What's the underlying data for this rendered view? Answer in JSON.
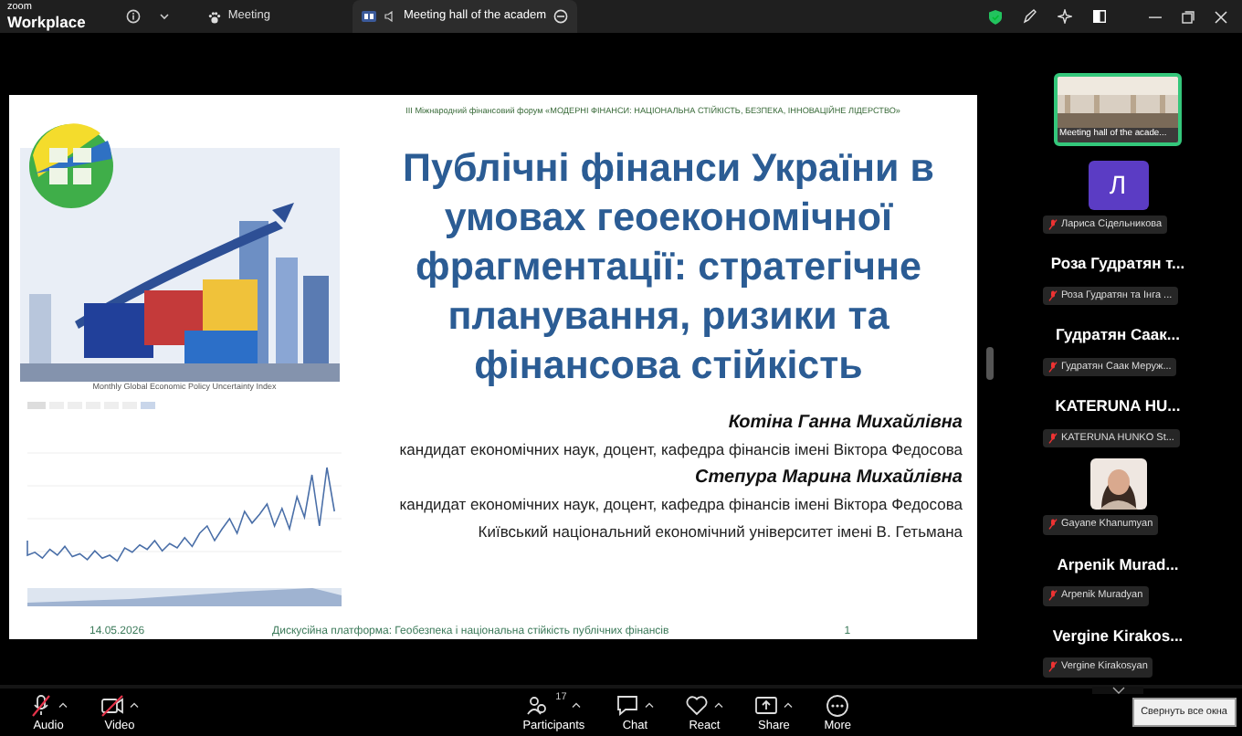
{
  "app": {
    "logo_top": "zoom",
    "logo_bottom": "Workplace"
  },
  "tabs": [
    {
      "label": "Meeting",
      "kind": "meeting",
      "selected": false
    },
    {
      "label": "Meeting hall of the academ",
      "kind": "share",
      "selected": true
    }
  ],
  "slide": {
    "header": "III Міжнародний фінансовий форум «МОДЕРНІ ФІНАНСИ: НАЦІОНАЛЬНА СТІЙКІСТЬ, БЕЗПЕКА, ІННОВАЦІЙНЕ ЛІДЕРСТВО»",
    "title_lines": [
      "Публічні фінанси України в",
      "умовах геоекономічної",
      "фрагментації: стратегічне",
      "планування, ризики та",
      "фінансова стійкість"
    ],
    "chart_title": "Monthly Global Economic Policy Uncertainty Index",
    "authors": [
      {
        "kind": "name",
        "text": "Котіна Ганна Михайлівна"
      },
      {
        "kind": "affiliation",
        "text": "кандидат економічних наук, доцент, кафедра фінансів імені Віктора Федосова"
      },
      {
        "kind": "name",
        "text": "Степура Марина Михайлівна"
      },
      {
        "kind": "affiliation",
        "text": "кандидат економічних наук, доцент, кафедра фінансів імені Віктора Федосова"
      },
      {
        "kind": "affiliation",
        "text": "Київський національний економічний університет  імені В. Гетьмана"
      }
    ],
    "footer": {
      "date": "14.05.2026",
      "platform": "Дискусійна платформа: Геобезпека і національна стійкість публічних фінансів",
      "page": "1"
    }
  },
  "participants": [
    {
      "kind": "video",
      "label": "Meeting hall of the acade...",
      "selected": true
    },
    {
      "kind": "avatar",
      "initial": "Л",
      "color": "#5b3cc4",
      "label": "Лариса Сідельникова",
      "selected": false,
      "muted": true
    },
    {
      "kind": "name",
      "name": "Роза Гудратян т...",
      "label": "Роза Гудратян та Інга ...",
      "selected": false,
      "muted": true
    },
    {
      "kind": "name",
      "name": "Гудратян Саак...",
      "label": "Гудратян Саак Меруж...",
      "selected": false,
      "muted": true
    },
    {
      "kind": "name",
      "name": "KATERUNA HU...",
      "label": "KATERUNA HUNKO St...",
      "selected": false,
      "muted": true
    },
    {
      "label": "Gayane Khanumyan",
      "selected": false,
      "muted": true
    },
    {
      "kind": "name",
      "name": "Arpenik Murad...",
      "label": "Arpenik Muradyan",
      "selected": false,
      "muted": true
    },
    {
      "kind": "name",
      "name": "Vergine Kirakos...",
      "label": "Vergine Kirakosyan",
      "selected": false,
      "muted": true
    }
  ],
  "toolbar": [
    {
      "kind": "audio",
      "label": "Audio",
      "off": true,
      "has_menu": true
    },
    {
      "kind": "video",
      "label": "Video",
      "off": true,
      "has_menu": true
    },
    {
      "kind": "participants",
      "label": "Participants",
      "count": "17",
      "has_menu": true
    },
    {
      "kind": "chat",
      "label": "Chat",
      "has_menu": true
    },
    {
      "kind": "react",
      "label": "React",
      "has_menu": true
    },
    {
      "kind": "share",
      "label": "Share",
      "has_menu": true
    },
    {
      "kind": "more",
      "label": "More",
      "has_menu": false
    }
  ],
  "tooltip": "Свернуть все окна"
}
